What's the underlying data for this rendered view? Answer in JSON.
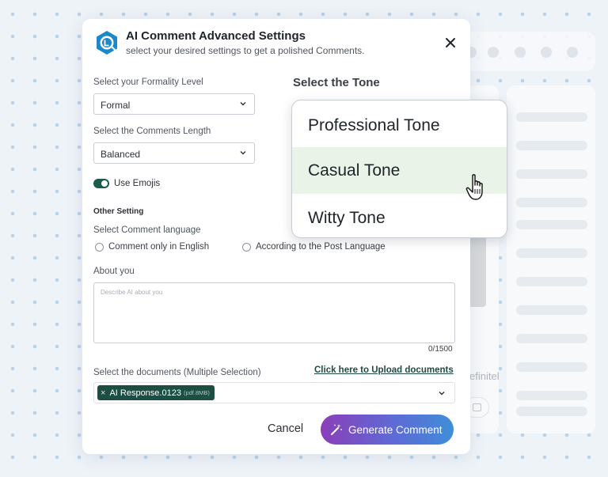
{
  "dialog": {
    "title": "AI Comment Advanced Settings",
    "subtitle": "select your desired settings to get a polished Comments.",
    "close_icon": "close-icon"
  },
  "formality": {
    "label": "Select your Formality Level",
    "value": "Formal"
  },
  "length": {
    "label": "Select the Comments Length",
    "value": "Balanced"
  },
  "emoji_toggle": {
    "label": "Use Emojis",
    "on": true
  },
  "other_setting": {
    "heading": "Other Setting",
    "language_label": "Select Comment language",
    "options": [
      "Comment only in English",
      "According to the Post Language"
    ]
  },
  "about": {
    "label": "About you",
    "placeholder": "Describe AI about you",
    "counter": "0/1500"
  },
  "documents": {
    "label": "Select the documents (Multiple Selection)",
    "upload_link": "Click here to Upload documents",
    "chip_name": "AI Response.0123",
    "chip_meta": "(pdf.8MB)",
    "chip_remove": "×"
  },
  "actions": {
    "cancel": "Cancel",
    "generate": "Generate Comment"
  },
  "tone": {
    "title": "Select the Tone",
    "options": [
      "Professional Tone",
      "Casual Tone",
      "Witty Tone"
    ],
    "highlighted_index": 1
  },
  "background": {
    "partial_text": "efinitel"
  },
  "colors": {
    "accent_green": "#1c5a4c",
    "highlight": "#e9f3e7",
    "button_gradient": [
      "#8b3fb8",
      "#3f8ed8"
    ]
  }
}
